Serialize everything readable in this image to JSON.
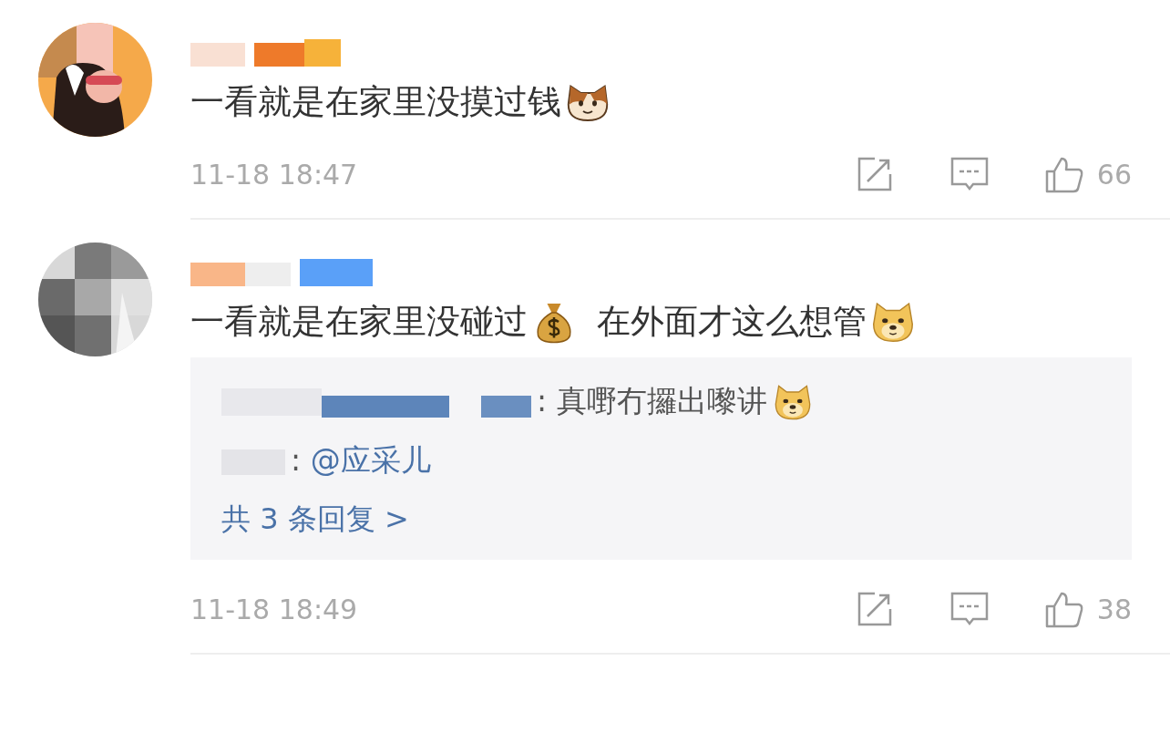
{
  "comments": [
    {
      "parts": [
        {
          "kind": "text",
          "text": "一看就是在家里没摸过钱"
        },
        {
          "kind": "cat"
        }
      ],
      "time": "11-18 18:47",
      "likes": "66"
    },
    {
      "parts": [
        {
          "kind": "text",
          "text": "一看就是在家里没碰过"
        },
        {
          "kind": "moneybag"
        },
        {
          "kind": "text",
          "text": "在外面才这么想管"
        },
        {
          "kind": "doge"
        }
      ],
      "time": "11-18 18:49",
      "likes": "38",
      "replies": [
        {
          "sep": ":",
          "text": "真嘢冇攞出嚟讲",
          "emoji": {
            "kind": "doge"
          }
        },
        {
          "sep": ":",
          "mention": "@应采儿"
        }
      ],
      "more": "共 3 条回复 >"
    }
  ]
}
